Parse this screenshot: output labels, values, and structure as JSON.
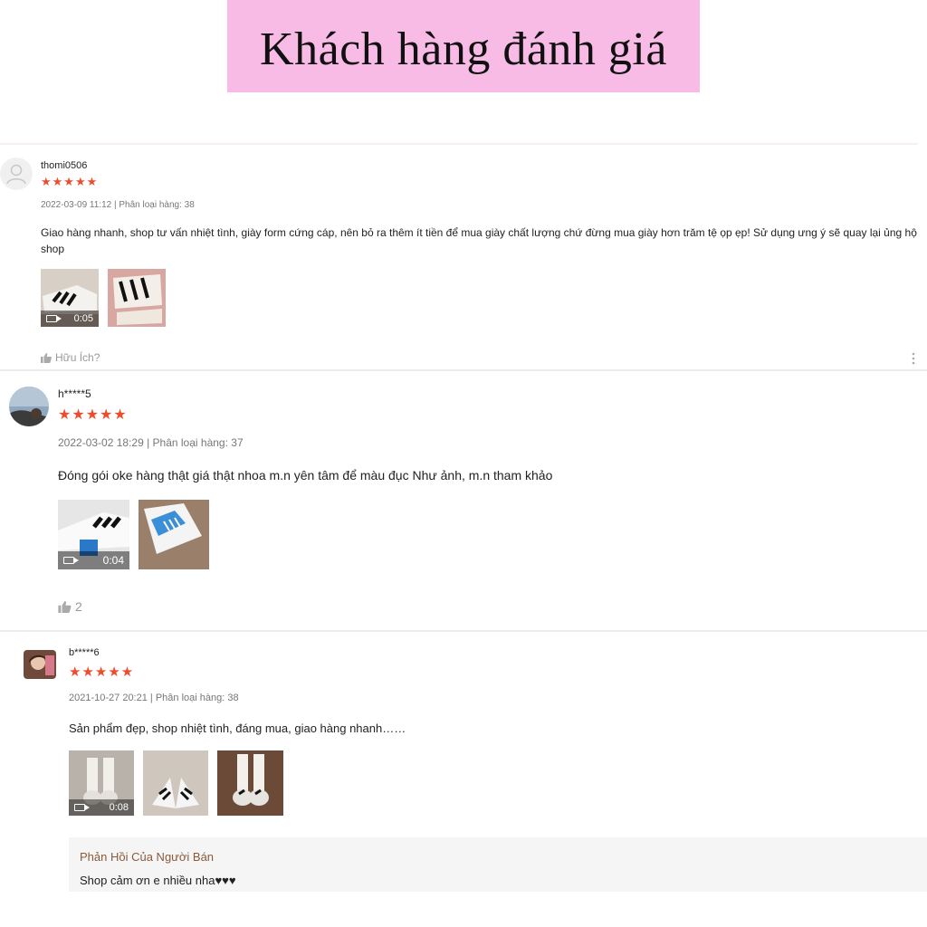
{
  "banner": {
    "title": "Khách hàng đánh giá"
  },
  "colors": {
    "banner_bg": "#f8bbe6",
    "star": "#ee4d2d",
    "reply_title": "#8a5a3a"
  },
  "reviews": [
    {
      "username": "thomi0506",
      "rating": 5,
      "stars": "★★★★★",
      "meta": "2022-03-09 11:12 | Phân loại hàng: 38",
      "comment": "Giao hàng nhanh, shop tư vấn nhiệt tình, giày form cứng cáp, nên bỏ ra thêm ít tiền để mua giày chất lượng chứ đừng mua giày hơn trăm tệ ọp ẹp! Sử dụng ưng ý sẽ quay lại ủng hộ shop",
      "video_duration": "0:05",
      "helpful_label": "Hữu Ích?",
      "more_icon": "more-vertical-icon"
    },
    {
      "username": "h*****5",
      "rating": 5,
      "stars": "★★★★★",
      "meta": "2022-03-02 18:29 | Phân loại hàng: 37",
      "comment": "Đóng gói oke hàng thật giá thật nhoa m.n yên tâm để màu đục Như ảnh, m.n tham khảo",
      "video_duration": "0:04",
      "helpful_count": "2"
    },
    {
      "username": "b*****6",
      "rating": 5,
      "stars": "★★★★★",
      "meta": "2021-10-27 20:21 | Phân loại hàng: 38",
      "comment": "Sản phẩm đẹp, shop nhiệt tình, đáng mua, giao hàng nhanh……",
      "video_duration": "0:08",
      "seller_reply": {
        "title": "Phản Hồi Của Người Bán",
        "text": "Shop cảm ơn e nhiều nha♥♥♥"
      }
    }
  ]
}
